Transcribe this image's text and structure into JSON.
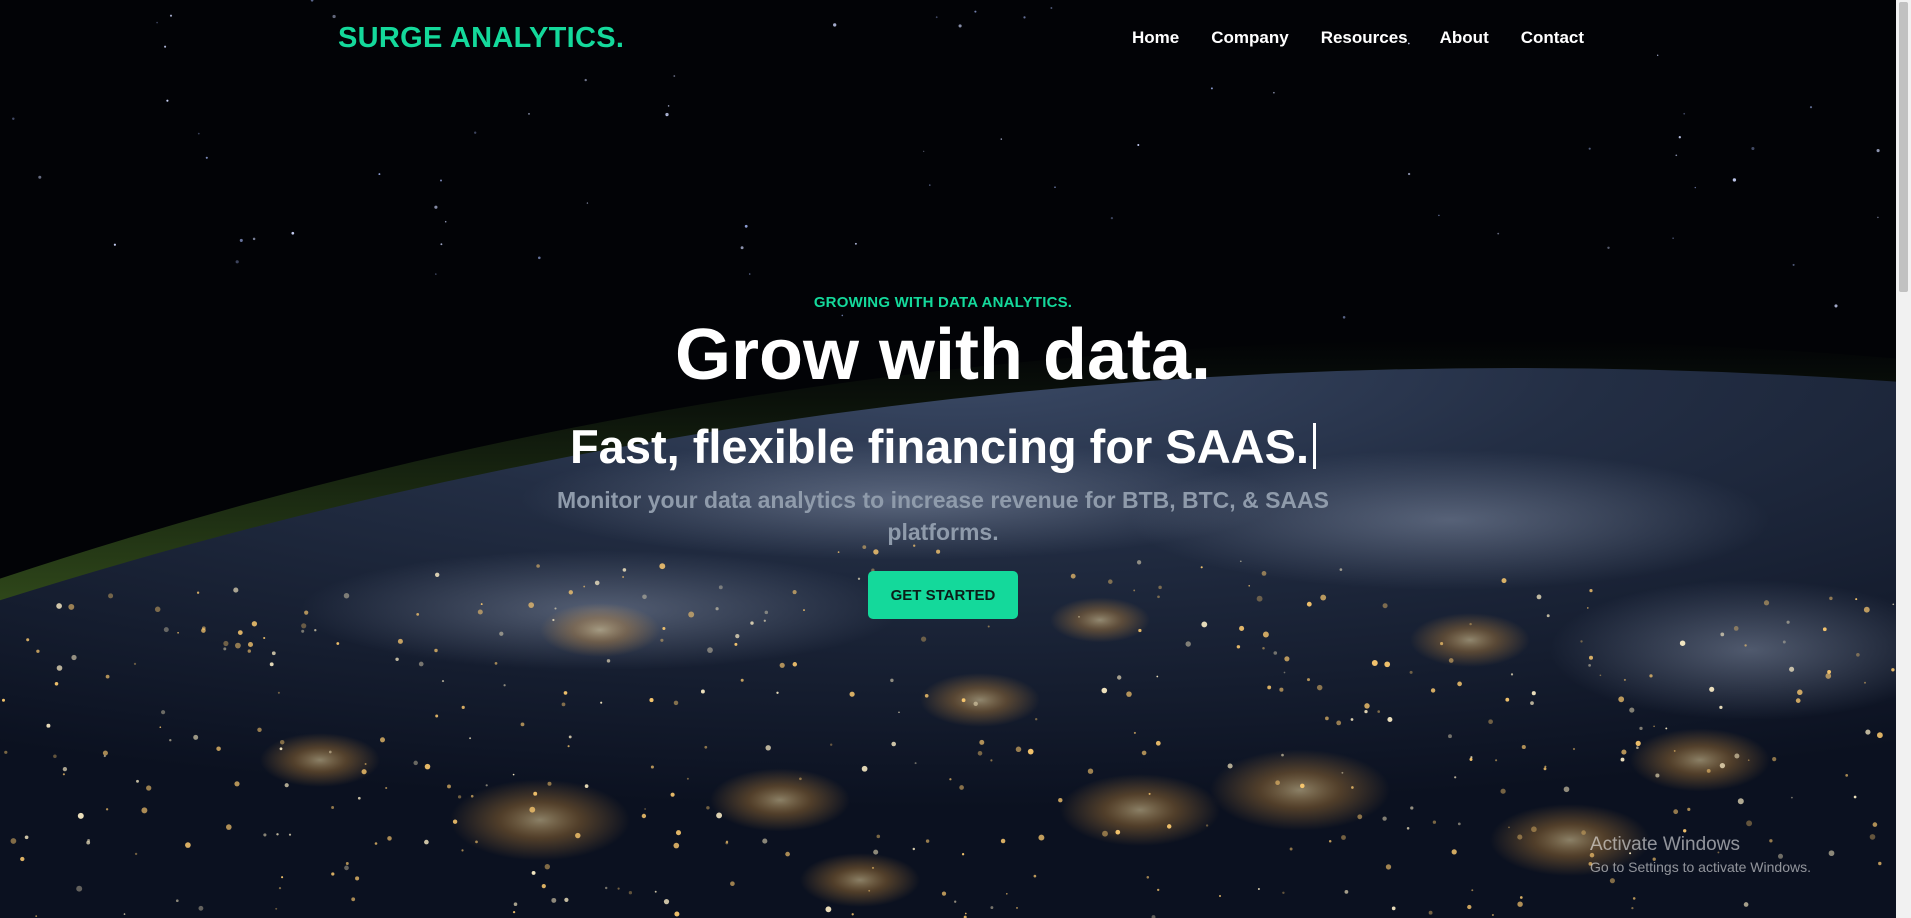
{
  "brand": {
    "name": "SURGE ANALYTICS.",
    "accent_color": "#14d99b"
  },
  "nav": {
    "items": [
      {
        "label": "Home"
      },
      {
        "label": "Company"
      },
      {
        "label": "Resources"
      },
      {
        "label": "About"
      },
      {
        "label": "Contact"
      }
    ]
  },
  "hero": {
    "eyebrow": "GROWING WITH DATA ANALYTICS.",
    "headline": "Grow with data.",
    "typed_text": "Fast, flexible financing for SAAS.",
    "description": "Monitor your data analytics to increase revenue for BTB, BTC, & SAAS platforms.",
    "cta_label": "GET STARTED",
    "background": "earth-at-night-from-space"
  },
  "windows_watermark": {
    "title": "Activate Windows",
    "subtitle": "Go to Settings to activate Windows."
  }
}
